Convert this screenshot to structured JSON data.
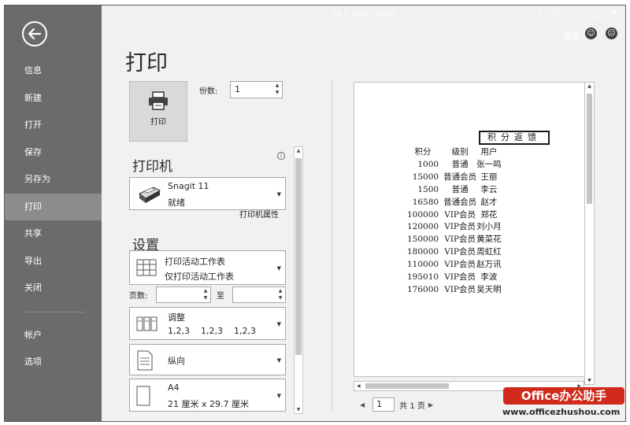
{
  "window": {
    "title": "15.1.xlsx - Excel",
    "help": "?",
    "restore": "❐",
    "minimize": "—",
    "maximize": "□",
    "close": "✕"
  },
  "account": {
    "signin": "登录"
  },
  "sidebar": {
    "items": [
      {
        "label": "信息"
      },
      {
        "label": "新建"
      },
      {
        "label": "打开"
      },
      {
        "label": "保存"
      },
      {
        "label": "另存为"
      },
      {
        "label": "打印"
      },
      {
        "label": "共享"
      },
      {
        "label": "导出"
      },
      {
        "label": "关闭"
      }
    ],
    "footer": [
      {
        "label": "帐户"
      },
      {
        "label": "选项"
      }
    ]
  },
  "print": {
    "title": "打印",
    "button_label": "打印",
    "copies_label": "份数:",
    "copies_value": "1",
    "printer_heading": "打印机",
    "printer_name": "Snagit 11",
    "printer_status": "就绪",
    "printer_props": "打印机属性",
    "settings_heading": "设置",
    "scope_title": "打印活动工作表",
    "scope_sub": "仅打印活动工作表",
    "pages_label": "页数:",
    "to_label": "至",
    "collate_title": "调整",
    "collate_sub": "1,2,3    1,2,3    1,2,3",
    "orientation": "纵向",
    "paper_title": "A4",
    "paper_sub": "21 厘米 x 29.7 厘米"
  },
  "preview": {
    "sheet_title": "积分返馈",
    "headers": [
      "积分",
      "级别",
      "用户"
    ],
    "rows": [
      [
        "1000",
        "普通",
        "张一鸣"
      ],
      [
        "15000",
        "普通会员",
        "王丽"
      ],
      [
        "1500",
        "普通",
        "李云"
      ],
      [
        "16580",
        "普通会员",
        "赵才"
      ],
      [
        "100000",
        "VIP会员",
        "郑花"
      ],
      [
        "120000",
        "VIP会员",
        "刘小月"
      ],
      [
        "150000",
        "VIP会员",
        "黄菜花"
      ],
      [
        "180000",
        "VIP会员",
        "周虹红"
      ],
      [
        "110000",
        "VIP会员",
        "赵万讯"
      ],
      [
        "195010",
        "VIP会员",
        "李波"
      ],
      [
        "176000",
        "VIP会员",
        "吴天明"
      ]
    ],
    "page_current": "1",
    "page_total": "共 1 页"
  },
  "watermark": {
    "badge": "Office办公助手",
    "url": "www.officezhushou.com"
  }
}
